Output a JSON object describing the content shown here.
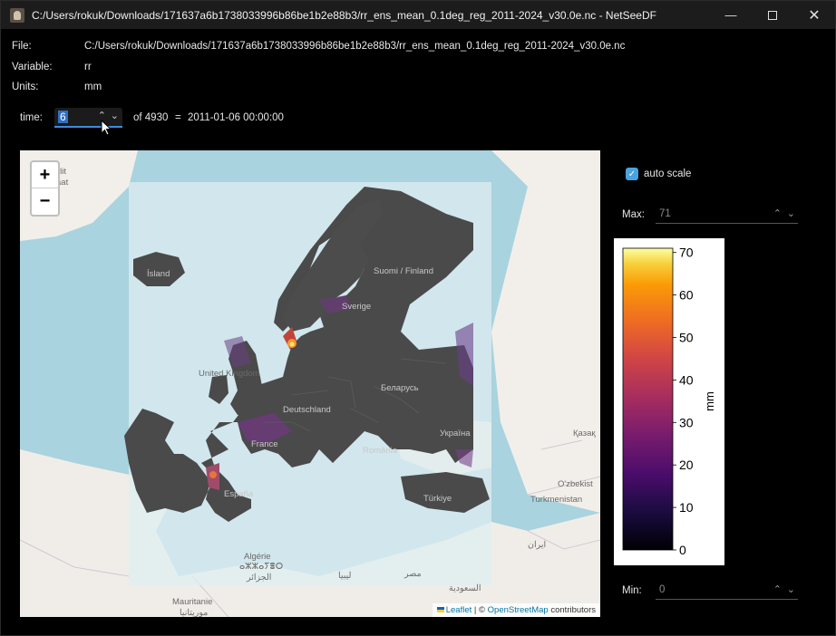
{
  "window": {
    "title": "C:/Users/rokuk/Downloads/171637a6b1738033996b86be1b2e88b3/rr_ens_mean_0.1deg_reg_2011-2024_v30.0e.nc - NetSeeDF",
    "icon": "app-logo-icon",
    "controls": [
      "minimize-icon",
      "maximize-icon",
      "close-icon"
    ]
  },
  "info": {
    "file_label": "File:",
    "file_value": "C:/Users/rokuk/Downloads/171637a6b1738033996b86be1b2e88b3/rr_ens_mean_0.1deg_reg_2011-2024_v30.0e.nc",
    "variable_label": "Variable:",
    "variable_value": "rr",
    "units_label": "Units:",
    "units_value": "mm"
  },
  "time": {
    "label": "time:",
    "value": "6",
    "of_text": "of 4930",
    "equals": "=",
    "date": "2011-01-06 00:00:00"
  },
  "map": {
    "zoom_in": "+",
    "zoom_out": "−",
    "attribution": {
      "leaflet": "Leaflet",
      "separator": "| ©",
      "osm": "OpenStreetMap",
      "contributors": "contributors"
    },
    "labels": [
      "llit",
      "aat",
      "Ísland",
      "Suomi / Finland",
      "Sverige",
      "United Kingdom",
      "Deutschland",
      "Беларусь",
      "France",
      "Україна",
      "România",
      "Қазақ",
      "España",
      "Türkiye",
      "O'zbekist",
      "Turkmenistan",
      "Algérie",
      "ⴰⵣⵣⴰⵢⴻⵔ",
      "الجزائر",
      "ليبيا",
      "مصر",
      "ایران",
      "السعودية",
      "Mauritanie",
      "موريتانيا"
    ]
  },
  "controls": {
    "auto_scale_label": "auto scale",
    "auto_scale_checked": true,
    "max_label": "Max:",
    "max_value": "71",
    "min_label": "Min:",
    "min_value": "0"
  },
  "colorbar": {
    "unit_label": "mm",
    "ticks": [
      "0",
      "10",
      "20",
      "30",
      "40",
      "50",
      "60",
      "70"
    ],
    "colormap": "inferno",
    "min": 0,
    "max": 71
  }
}
